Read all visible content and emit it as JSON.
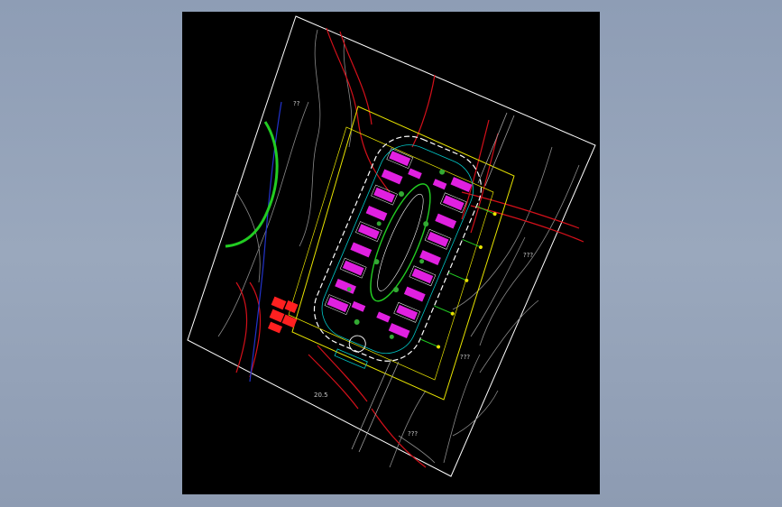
{
  "viewport": {
    "background": "#000000"
  },
  "drawing": {
    "site_boundary_color": "#ffffff",
    "road_color": "#d4101a",
    "contour_color": "#8a8a8a",
    "setback_color": "#e8e400",
    "green_belt_color": "#22cc22",
    "building_color": "#e020e0",
    "water_color": "#2233cc",
    "entrance_color": "#ff2020",
    "annotations": [
      "??",
      "???",
      "???",
      "???",
      "20.5"
    ]
  }
}
